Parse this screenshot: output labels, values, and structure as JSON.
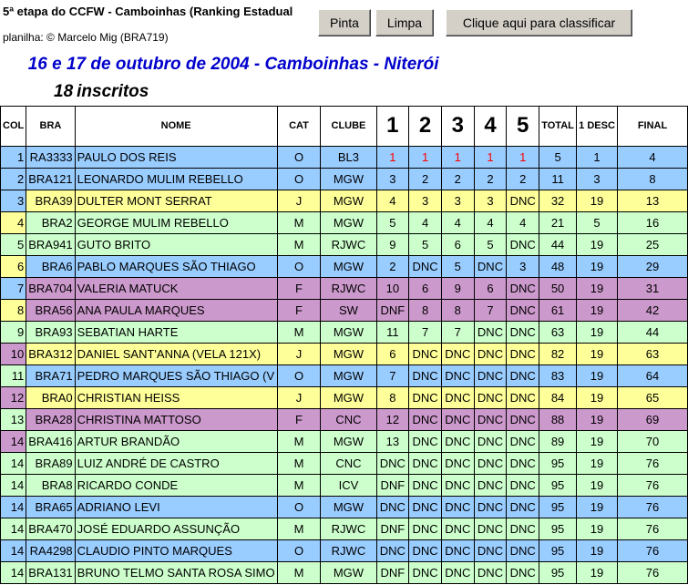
{
  "header": {
    "title": "5ª etapa do CCFW - Camboinhas (Ranking Estadual",
    "credit": "planilha: © Marcelo Mig (BRA719)",
    "event": "16 e 17 de outubro de 2004 - Camboinhas - Niterói",
    "inscritos_count": "18",
    "inscritos_label": "inscritos"
  },
  "buttons": {
    "pinta": "Pinta",
    "limpa": "Limpa",
    "classificar": "Clique aqui para classificar"
  },
  "columns": [
    "COL",
    "BRA",
    "NOME",
    "CAT",
    "CLUBE",
    "1",
    "2",
    "3",
    "4",
    "5",
    "TOTAL",
    "1 DESC",
    "FINAL"
  ],
  "colors": {
    "blue": "#99ccff",
    "green": "#ccffcc",
    "yellow": "#ffff99",
    "purple": "#cc99cc",
    "red_text": "#ff0000"
  },
  "rows": [
    {
      "col": "1",
      "bra": "RA3333",
      "nome": "PAULO DOS REIS",
      "cat": "O",
      "clube": "BL3",
      "r1": "1",
      "r2": "1",
      "r3": "1",
      "r4": "1",
      "r5": "1",
      "total": "5",
      "desc": "1",
      "final": "4",
      "color": "blue",
      "col_color": "blue",
      "red": true
    },
    {
      "col": "2",
      "bra": "BRA121",
      "nome": "LEONARDO MULIM REBELLO",
      "cat": "O",
      "clube": "MGW",
      "r1": "3",
      "r2": "2",
      "r3": "2",
      "r4": "2",
      "r5": "2",
      "total": "11",
      "desc": "3",
      "final": "8",
      "color": "blue",
      "col_color": "blue"
    },
    {
      "col": "3",
      "bra": "BRA39",
      "nome": "DULTER MONT SERRAT",
      "cat": "J",
      "clube": "MGW",
      "r1": "4",
      "r2": "3",
      "r3": "3",
      "r4": "3",
      "r5": "DNC",
      "total": "32",
      "desc": "19",
      "final": "13",
      "color": "yellow",
      "col_color": "blue"
    },
    {
      "col": "4",
      "bra": "BRA2",
      "nome": "GEORGE MULIM REBELLO",
      "cat": "M",
      "clube": "MGW",
      "r1": "5",
      "r2": "4",
      "r3": "4",
      "r4": "4",
      "r5": "4",
      "total": "21",
      "desc": "5",
      "final": "16",
      "color": "green",
      "col_color": "yellow"
    },
    {
      "col": "5",
      "bra": "BRA941",
      "nome": "GUTO BRITO",
      "cat": "M",
      "clube": "RJWC",
      "r1": "9",
      "r2": "5",
      "r3": "6",
      "r4": "5",
      "r5": "DNC",
      "total": "44",
      "desc": "19",
      "final": "25",
      "color": "green",
      "col_color": "green"
    },
    {
      "col": "6",
      "bra": "BRA6",
      "nome": "PABLO MARQUES SÃO THIAGO",
      "cat": "O",
      "clube": "MGW",
      "r1": "2",
      "r2": "DNC",
      "r3": "5",
      "r4": "DNC",
      "r5": "3",
      "total": "48",
      "desc": "19",
      "final": "29",
      "color": "blue",
      "col_color": "yellow"
    },
    {
      "col": "7",
      "bra": "BRA704",
      "nome": "VALERIA MATUCK",
      "cat": "F",
      "clube": "RJWC",
      "r1": "10",
      "r2": "6",
      "r3": "9",
      "r4": "6",
      "r5": "DNC",
      "total": "50",
      "desc": "19",
      "final": "31",
      "color": "purple",
      "col_color": "blue"
    },
    {
      "col": "8",
      "bra": "BRA56",
      "nome": "ANA PAULA MARQUES",
      "cat": "F",
      "clube": "SW",
      "r1": "DNF",
      "r2": "8",
      "r3": "8",
      "r4": "7",
      "r5": "DNC",
      "total": "61",
      "desc": "19",
      "final": "42",
      "color": "purple",
      "col_color": "yellow"
    },
    {
      "col": "9",
      "bra": "BRA93",
      "nome": "SEBATIAN HARTE",
      "cat": "M",
      "clube": "MGW",
      "r1": "11",
      "r2": "7",
      "r3": "7",
      "r4": "DNC",
      "r5": "DNC",
      "total": "63",
      "desc": "19",
      "final": "44",
      "color": "green",
      "col_color": "green"
    },
    {
      "col": "10",
      "bra": "BRA312",
      "nome": "DANIEL SANT'ANNA (VELA 121X)",
      "cat": "J",
      "clube": "MGW",
      "r1": "6",
      "r2": "DNC",
      "r3": "DNC",
      "r4": "DNC",
      "r5": "DNC",
      "total": "82",
      "desc": "19",
      "final": "63",
      "color": "yellow",
      "col_color": "purple"
    },
    {
      "col": "11",
      "bra": "BRA71",
      "nome": "PEDRO MARQUES SÃO THIAGO (V",
      "cat": "O",
      "clube": "MGW",
      "r1": "7",
      "r2": "DNC",
      "r3": "DNC",
      "r4": "DNC",
      "r5": "DNC",
      "total": "83",
      "desc": "19",
      "final": "64",
      "color": "blue",
      "col_color": "green"
    },
    {
      "col": "12",
      "bra": "BRA0",
      "nome": "CHRISTIAN HEISS",
      "cat": "J",
      "clube": "MGW",
      "r1": "8",
      "r2": "DNC",
      "r3": "DNC",
      "r4": "DNC",
      "r5": "DNC",
      "total": "84",
      "desc": "19",
      "final": "65",
      "color": "yellow",
      "col_color": "purple"
    },
    {
      "col": "13",
      "bra": "BRA28",
      "nome": "CHRISTINA MATTOSO",
      "cat": "F",
      "clube": "CNC",
      "r1": "12",
      "r2": "DNC",
      "r3": "DNC",
      "r4": "DNC",
      "r5": "DNC",
      "total": "88",
      "desc": "19",
      "final": "69",
      "color": "purple",
      "col_color": "green"
    },
    {
      "col": "14",
      "bra": "BRA416",
      "nome": "ARTUR BRANDÃO",
      "cat": "M",
      "clube": "MGW",
      "r1": "13",
      "r2": "DNC",
      "r3": "DNC",
      "r4": "DNC",
      "r5": "DNC",
      "total": "89",
      "desc": "19",
      "final": "70",
      "color": "green",
      "col_color": "purple"
    },
    {
      "col": "14",
      "bra": "BRA89",
      "nome": "LUIZ ANDRÉ DE CASTRO",
      "cat": "M",
      "clube": "CNC",
      "r1": "DNC",
      "r2": "DNC",
      "r3": "DNC",
      "r4": "DNC",
      "r5": "DNC",
      "total": "95",
      "desc": "19",
      "final": "76",
      "color": "green",
      "col_color": "green"
    },
    {
      "col": "14",
      "bra": "BRA8",
      "nome": "RICARDO CONDE",
      "cat": "M",
      "clube": "ICV",
      "r1": "DNF",
      "r2": "DNC",
      "r3": "DNC",
      "r4": "DNC",
      "r5": "DNC",
      "total": "95",
      "desc": "19",
      "final": "76",
      "color": "green",
      "col_color": "green"
    },
    {
      "col": "14",
      "bra": "BRA65",
      "nome": "ADRIANO LEVI",
      "cat": "O",
      "clube": "MGW",
      "r1": "DNC",
      "r2": "DNC",
      "r3": "DNC",
      "r4": "DNC",
      "r5": "DNC",
      "total": "95",
      "desc": "19",
      "final": "76",
      "color": "blue",
      "col_color": "blue"
    },
    {
      "col": "14",
      "bra": "BRA470",
      "nome": "JOSÉ EDUARDO ASSUNÇÃO",
      "cat": "M",
      "clube": "RJWC",
      "r1": "DNF",
      "r2": "DNC",
      "r3": "DNC",
      "r4": "DNC",
      "r5": "DNC",
      "total": "95",
      "desc": "19",
      "final": "76",
      "color": "green",
      "col_color": "green"
    },
    {
      "col": "14",
      "bra": "RA4298",
      "nome": "CLAUDIO PINTO MARQUES",
      "cat": "O",
      "clube": "RJWC",
      "r1": "DNC",
      "r2": "DNC",
      "r3": "DNC",
      "r4": "DNC",
      "r5": "DNC",
      "total": "95",
      "desc": "19",
      "final": "76",
      "color": "blue",
      "col_color": "blue"
    },
    {
      "col": "14",
      "bra": "BRA131",
      "nome": "BRUNO TELMO SANTA ROSA SIMO",
      "cat": "M",
      "clube": "MGW",
      "r1": "DNF",
      "r2": "DNC",
      "r3": "DNC",
      "r4": "DNC",
      "r5": "DNC",
      "total": "95",
      "desc": "19",
      "final": "76",
      "color": "green",
      "col_color": "green"
    }
  ]
}
